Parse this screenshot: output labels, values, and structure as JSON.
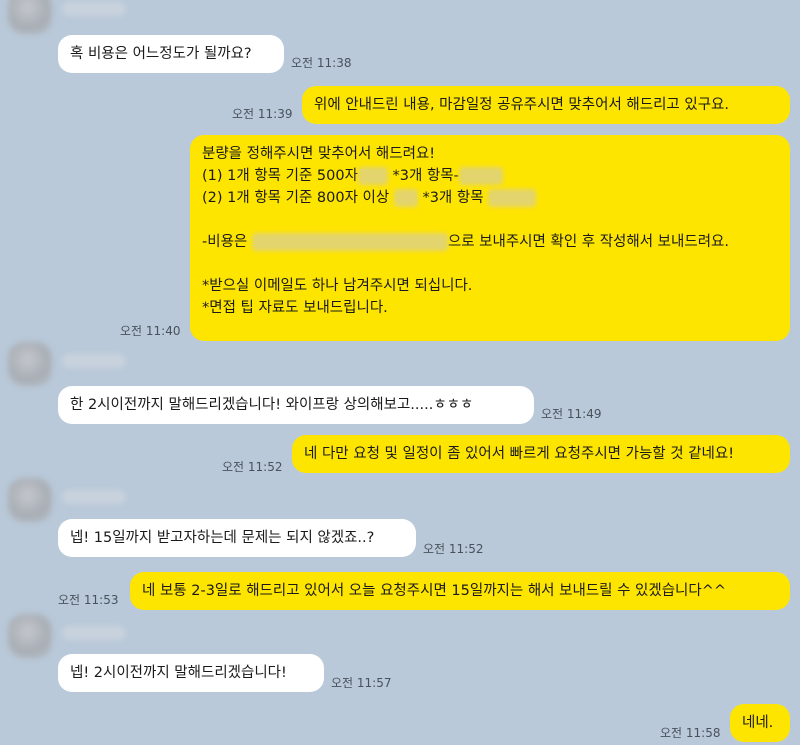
{
  "colors": {
    "background": "#b9c9d9",
    "incoming_bubble": "#ffffff",
    "outgoing_bubble": "#fee500"
  },
  "messages": [
    {
      "side": "in",
      "text": "혹 비용은 어느정도가 될까요?",
      "time": "오전 11:38"
    },
    {
      "side": "out",
      "text": "위에 안내드린 내용, 마감일정 공유주시면 맞추어서 해드리고 있구요.",
      "time": "오전 11:39"
    },
    {
      "side": "out",
      "lines": [
        "분량을 정해주시면 맞추어서 해드려요!",
        "(1) 1개 항목 기준 500자",
        "*3개 항목-",
        "(2) 1개 항목 기준 800자 이상",
        "*3개 항목",
        "-비용은",
        "으로 보내주시면 확인 후 작성해서 보내드려요.",
        "*받으실 이메일도 하나 남겨주시면 되십니다.",
        "*면접 팁 자료도 보내드립니다."
      ],
      "time": "오전 11:40"
    },
    {
      "side": "in",
      "text": "한 2시이전까지 말해드리겠습니다! 와이프랑 상의해보고.....ㅎㅎㅎ",
      "time": "오전 11:49"
    },
    {
      "side": "out",
      "text": "네 다만 요청 및 일정이 좀 있어서 빠르게 요청주시면 가능할 것 같네요!",
      "time": "오전 11:52"
    },
    {
      "side": "in",
      "text": "넵! 15일까지 받고자하는데 문제는 되지 않겠죠..?",
      "time": "오전 11:52"
    },
    {
      "side": "out",
      "text": "네 보통 2-3일로 해드리고 있어서 오늘 요청주시면 15일까지는 해서 보내드릴 수 있겠습니다^^",
      "time": "오전 11:53"
    },
    {
      "side": "in",
      "text": "넵! 2시이전까지 말해드리겠습니다!",
      "time": "오전 11:57"
    },
    {
      "side": "out",
      "text": "네네.",
      "time": "오전 11:58"
    }
  ]
}
